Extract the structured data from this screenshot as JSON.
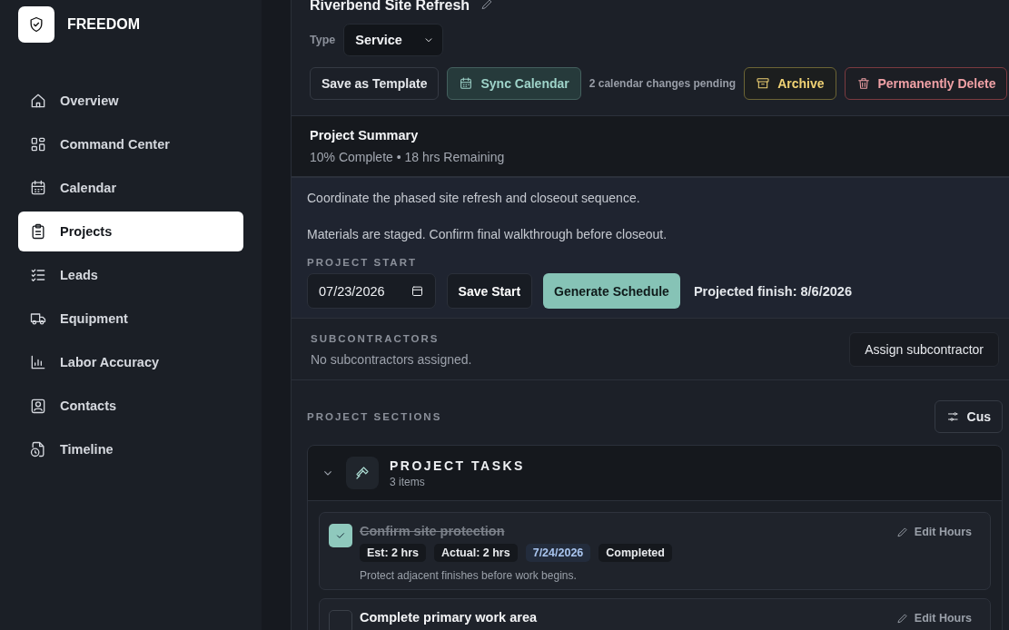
{
  "brand": {
    "name": "FREEDOM"
  },
  "sidebar": {
    "items": [
      {
        "label": "Overview",
        "selected": false
      },
      {
        "label": "Command Center",
        "selected": false
      },
      {
        "label": "Calendar",
        "selected": false
      },
      {
        "label": "Projects",
        "selected": true
      },
      {
        "label": "Leads",
        "selected": false
      },
      {
        "label": "Equipment",
        "selected": false
      },
      {
        "label": "Labor Accuracy",
        "selected": false
      },
      {
        "label": "Contacts",
        "selected": false
      },
      {
        "label": "Timeline",
        "selected": false
      }
    ]
  },
  "project": {
    "title": "Riverbend Site Refresh",
    "type_label": "Type",
    "type_value": "Service",
    "toolbar": [
      {
        "kind": "plain",
        "label": "Save as Template"
      },
      {
        "kind": "sync",
        "label": "Sync Calendar"
      },
      {
        "kind": "note",
        "label": "2 calendar changes pending"
      },
      {
        "kind": "archive",
        "label": "Archive"
      },
      {
        "kind": "danger",
        "label": "Permanently Delete"
      }
    ]
  },
  "summary": {
    "title": "Project Summary",
    "progress": "10% Complete • 18 hrs Remaining"
  },
  "details": {
    "description": [
      "Coordinate the phased site refresh and closeout sequence.",
      "Materials are staged. Confirm final walkthrough before closeout."
    ],
    "start_label": "PROJECT START",
    "start_date": "07/23/2026",
    "save_start": "Save Start",
    "generate": "Generate Schedule",
    "projected": "Projected finish: 8/6/2026"
  },
  "subcontractors": {
    "label": "SUBCONTRACTORS",
    "empty": "No subcontractors assigned.",
    "assign": "Assign subcontractor"
  },
  "sections": {
    "label": "PROJECT SECTIONS",
    "customize": "Cus",
    "group": {
      "title": "PROJECT TASKS",
      "count": "3 items",
      "expanded": true,
      "tasks": [
        {
          "title": "Confirm site protection",
          "checked": true,
          "chips": [
            {
              "kind": "plain",
              "text": "Est: 2 hrs"
            },
            {
              "kind": "plain",
              "text": "Actual: 2 hrs"
            },
            {
              "kind": "date",
              "text": "7/24/2026"
            },
            {
              "kind": "plain",
              "text": "Completed"
            }
          ],
          "note": "Protect adjacent finishes before work begins.",
          "edit": "Edit Hours"
        },
        {
          "title": "Complete primary work area",
          "checked": false,
          "edit": "Edit Hours"
        }
      ]
    }
  }
}
